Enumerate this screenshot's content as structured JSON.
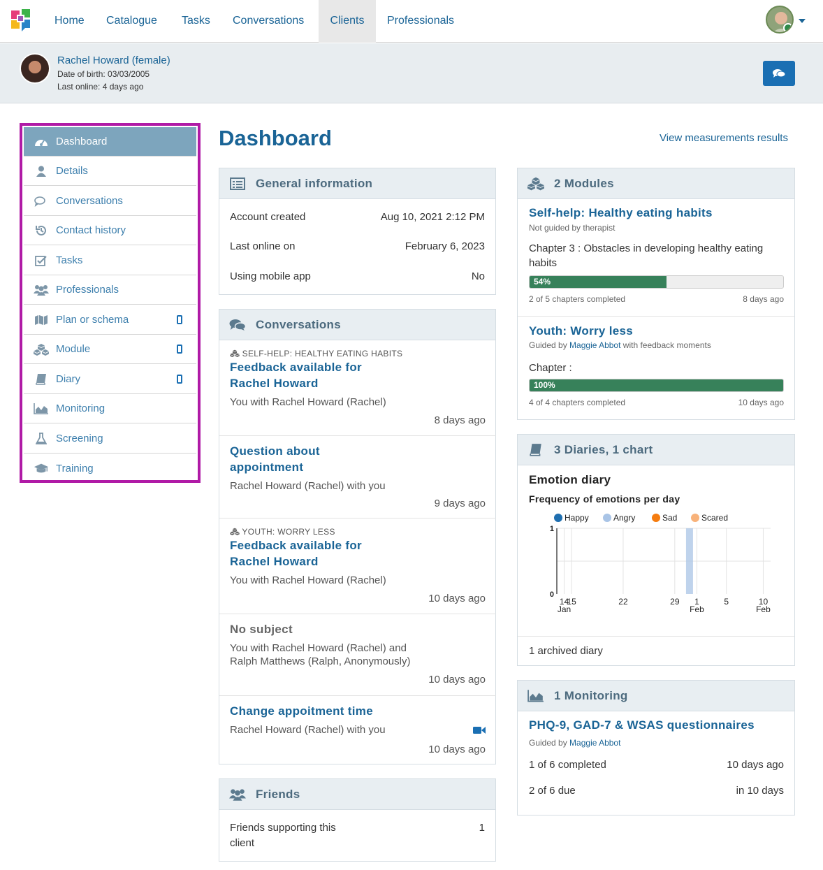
{
  "nav": {
    "items": [
      {
        "label": "Home",
        "active": false
      },
      {
        "label": "Catalogue",
        "active": false
      },
      {
        "label": "Tasks",
        "active": false
      },
      {
        "label": "Conversations",
        "active": false
      },
      {
        "label": "Clients",
        "active": true
      },
      {
        "label": "Professionals",
        "active": false
      }
    ]
  },
  "client": {
    "name": "Rachel Howard (female)",
    "dob": "Date of birth: 03/03/2005",
    "last_online": "Last online: 4 days ago"
  },
  "sidebar": {
    "items": [
      {
        "label": "Dashboard",
        "icon": "dashboard-icon",
        "active": true,
        "mobile": false
      },
      {
        "label": "Details",
        "icon": "user-icon",
        "active": false,
        "mobile": false
      },
      {
        "label": "Conversations",
        "icon": "comments-icon",
        "active": false,
        "mobile": false
      },
      {
        "label": "Contact history",
        "icon": "history-icon",
        "active": false,
        "mobile": false
      },
      {
        "label": "Tasks",
        "icon": "checkbox-icon",
        "active": false,
        "mobile": false
      },
      {
        "label": "Professionals",
        "icon": "users-icon",
        "active": false,
        "mobile": false
      },
      {
        "label": "Plan or schema",
        "icon": "map-icon",
        "active": false,
        "mobile": true
      },
      {
        "label": "Module",
        "icon": "cubes-icon",
        "active": false,
        "mobile": true
      },
      {
        "label": "Diary",
        "icon": "book-icon",
        "active": false,
        "mobile": true
      },
      {
        "label": "Monitoring",
        "icon": "area-chart-icon",
        "active": false,
        "mobile": false
      },
      {
        "label": "Screening",
        "icon": "flask-icon",
        "active": false,
        "mobile": false
      },
      {
        "label": "Training",
        "icon": "graduation-cap-icon",
        "active": false,
        "mobile": false
      }
    ]
  },
  "main": {
    "title": "Dashboard",
    "view_link": "View measurements results"
  },
  "general": {
    "heading": "General information",
    "rows": [
      {
        "label": "Account created",
        "value": "Aug 10, 2021 2:12 PM"
      },
      {
        "label": "Last online on",
        "value": "February 6, 2023"
      },
      {
        "label": "Using mobile app",
        "value": "No"
      }
    ]
  },
  "conversations": {
    "heading": "Conversations",
    "items": [
      {
        "category": "SELF-HELP: HEALTHY EATING HABITS",
        "title": "Feedback available for Rachel Howard",
        "subtitle": "You with Rachel Howard (Rachel)",
        "time": "8 days ago"
      },
      {
        "category": "",
        "title": "Question about appointment",
        "subtitle": "Rachel Howard (Rachel) with you",
        "time": "9 days ago"
      },
      {
        "category": "YOUTH: WORRY LESS",
        "title": "Feedback available for Rachel Howard",
        "subtitle": "You with Rachel Howard (Rachel)",
        "time": "10 days ago"
      },
      {
        "category": "",
        "title": "No subject",
        "subtitle": "You with Rachel Howard (Rachel) and Ralph Matthews (Ralph, Anonymously)",
        "time": "10 days ago"
      },
      {
        "category": "",
        "title": "Change appoitment time",
        "subtitle": "Rachel Howard (Rachel) with you",
        "time": "10 days ago",
        "video": true
      }
    ]
  },
  "friends": {
    "heading": "Friends",
    "label": "Friends supporting this client",
    "value": "1"
  },
  "modules": {
    "heading": "2 Modules",
    "items": [
      {
        "title": "Self-help: Healthy eating habits",
        "guided_prefix": "Not guided by therapist",
        "guided_name": "",
        "guided_suffix": "",
        "chapter": "Chapter 3 : Obstacles in developing healthy eating habits",
        "progress": 54,
        "progress_label": "54%",
        "completed": "2 of 5 chapters completed",
        "time": "8 days ago"
      },
      {
        "title": "Youth: Worry less",
        "guided_prefix": "Guided by ",
        "guided_name": "Maggie Abbot",
        "guided_suffix": " with feedback moments",
        "chapter": "Chapter :",
        "progress": 100,
        "progress_label": "100%",
        "completed": "4 of 4 chapters completed",
        "time": "10 days ago"
      }
    ]
  },
  "diaries": {
    "heading": "3 Diaries, 1 chart",
    "diary_title": "Emotion diary",
    "archived": "1 archived diary"
  },
  "chart_data": {
    "type": "bar",
    "title": "Frequency of emotions per day",
    "series": [
      {
        "name": "Happy",
        "color": "#1f6fb0"
      },
      {
        "name": "Angry",
        "color": "#a9c4e6"
      },
      {
        "name": "Sad",
        "color": "#f57c0f"
      },
      {
        "name": "Scared",
        "color": "#f8b27a"
      }
    ],
    "ylim": [
      0,
      1
    ],
    "yticks": [
      "0",
      "1"
    ],
    "xticks": [
      {
        "label": "14",
        "sub": "Jan",
        "day": 14
      },
      {
        "label": "15",
        "sub": "",
        "day": 15
      },
      {
        "label": "22",
        "sub": "",
        "day": 22
      },
      {
        "label": "29",
        "sub": "",
        "day": 29
      },
      {
        "label": "1",
        "sub": "Feb",
        "day": 32
      },
      {
        "label": "5",
        "sub": "",
        "day": 36
      },
      {
        "label": "10",
        "sub": "Feb",
        "day": 41
      }
    ],
    "xrange": [
      13,
      42
    ],
    "bars": [
      {
        "day": 31,
        "series": "Angry",
        "value": 1
      }
    ],
    "legend_position": "top-left"
  },
  "monitoring": {
    "heading": "1 Monitoring",
    "title": "PHQ-9, GAD-7 & WSAS questionnaires",
    "guided_prefix": "Guided by ",
    "guided_name": "Maggie Abbot",
    "rows": [
      {
        "label": "1 of 6 completed",
        "value": "10 days ago"
      },
      {
        "label": "2 of 6 due",
        "value": "in 10 days"
      }
    ]
  }
}
